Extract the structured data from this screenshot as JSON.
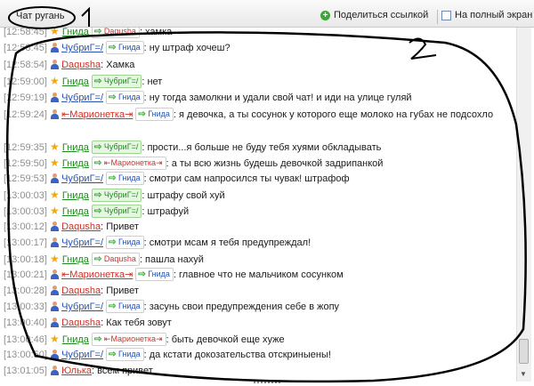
{
  "toolbar": {
    "chat_title": "Чат ругань",
    "share_label": "Поделиться ссылкой",
    "fullscreen_label": "На полный экран"
  },
  "annotations": {
    "one": "1",
    "two": "2"
  },
  "messages": [
    {
      "time": "[12:58:45]",
      "nick": "Гнида",
      "to": "Daqusha",
      "text": ": хамка"
    },
    {
      "time": "[12:58:45]",
      "nick": "ЧубриГ=/",
      "to": "Гнида",
      "text": ": ну штраф хочеш?"
    },
    {
      "time": "[12:58:54]",
      "nick": "Daqusha",
      "text": ": Хамка"
    },
    {
      "time": "[12:59:00]",
      "nick": "Гнида",
      "to": "ЧубриГ=/",
      "text": ": нет"
    },
    {
      "time": "[12:59:19]",
      "nick": "ЧубриГ=/",
      "to": "Гнида",
      "text": ": ну тогда замолкни и удали свой чат! и иди на улице гуляй"
    },
    {
      "time": "[12:59:24]",
      "nick": "Марионетка",
      "to": "Гнида",
      "text": ": я девочка, а ты сосунок у которого еще молоко на губах не подсохло"
    },
    {
      "time": "[12:59:35]",
      "nick": "Гнида",
      "to": "ЧубриГ=/",
      "text": ": прости...я больше не буду тебя хуями обкладывать"
    },
    {
      "time": "[12:59:50]",
      "nick": "Гнида",
      "to": "Марионетка",
      "text": ": а ты всю жизнь будешь девочкой задрипанкой"
    },
    {
      "time": "[12:59:53]",
      "nick": "ЧубриГ=/",
      "to": "Гнида",
      "text": ": смотри сам напросился ты чувак! штрафоф"
    },
    {
      "time": "[13:00:03]",
      "nick": "Гнида",
      "to": "ЧубриГ=/",
      "text": ": штрафу свой хуй"
    },
    {
      "time": "[13:00:03]",
      "nick": "Гнида",
      "to": "ЧубриГ=/",
      "text": ": штрафуй"
    },
    {
      "time": "[13:00:12]",
      "nick": "Daqusha",
      "text": ": Привет"
    },
    {
      "time": "[13:00:17]",
      "nick": "ЧубриГ=/",
      "to": "Гнида",
      "text": ": смотри мсам я тебя предупреждал!"
    },
    {
      "time": "[13:00:18]",
      "nick": "Гнида",
      "to": "Daqusha",
      "text": ": пашла нахуй"
    },
    {
      "time": "[13:00:21]",
      "nick": "Марионетка",
      "to": "Гнида",
      "text": ": главное что не мальчиком сосунком"
    },
    {
      "time": "[13:00:28]",
      "nick": "Daqusha",
      "text": ": Привет"
    },
    {
      "time": "[13:00:33]",
      "nick": "ЧубриГ=/",
      "to": "Гнида",
      "text": ": засунь свои предупреждения себе в жопу"
    },
    {
      "time": "[13:00:40]",
      "nick": "Daqusha",
      "text": ": Как тебя зовут"
    },
    {
      "time": "[13:00:46]",
      "nick": "Гнида",
      "to": "Марионетка",
      "text": ": быть девочкой еще хуже"
    },
    {
      "time": "[13:00:50]",
      "nick": "ЧубриГ=/",
      "to": "Гнида",
      "text": ": да кстати докозательства отскриныены!"
    },
    {
      "time": "[13:01:05]",
      "nick": "Юлька",
      "text": ": всем привет"
    }
  ],
  "colors": {
    "gnida": "#1f8a1f",
    "chubrig": "#2353b8",
    "daqusha": "#d03027",
    "marionetka": "#d03027",
    "julka": "#d03027"
  }
}
